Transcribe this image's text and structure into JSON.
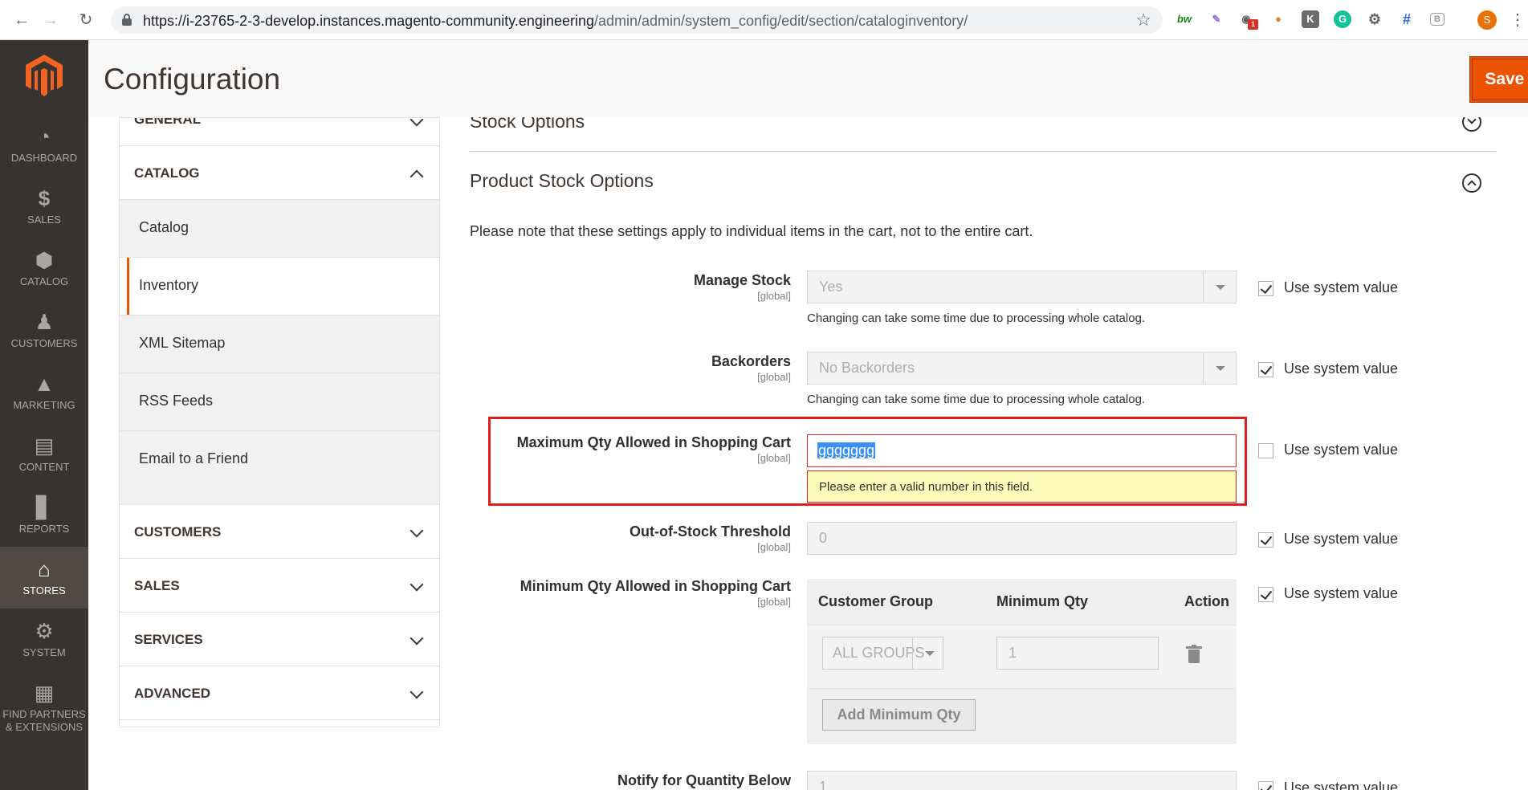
{
  "browser": {
    "url_host": "https://i-23765-2-3-develop.instances.magento-community.engineering",
    "url_path": "/admin/admin/system_config/edit/section/cataloginventory/",
    "badge_count": "1",
    "profile_initial": "S",
    "ext_bw": "bw",
    "ext_k": "K",
    "ext_g": "G",
    "ext_b": "B"
  },
  "sidebar": {
    "items": [
      {
        "label": "DASHBOARD",
        "icon": "dashboard-icon"
      },
      {
        "label": "SALES",
        "icon": "dollar-icon"
      },
      {
        "label": "CATALOG",
        "icon": "cube-icon"
      },
      {
        "label": "CUSTOMERS",
        "icon": "person-icon"
      },
      {
        "label": "MARKETING",
        "icon": "megaphone-icon"
      },
      {
        "label": "CONTENT",
        "icon": "layout-icon"
      },
      {
        "label": "REPORTS",
        "icon": "bar-chart-icon"
      },
      {
        "label": "STORES",
        "icon": "store-icon"
      },
      {
        "label": "SYSTEM",
        "icon": "gear-icon"
      },
      {
        "label_line1": "FIND PARTNERS",
        "label_line2": "& EXTENSIONS",
        "icon": "blocks-icon"
      }
    ]
  },
  "header": {
    "title": "Configuration",
    "save_label": "Save Config"
  },
  "tabs": {
    "general": "GENERAL",
    "catalog": "CATALOG",
    "catalog_items": [
      "Catalog",
      "Inventory",
      "XML Sitemap",
      "RSS Feeds",
      "Email to a Friend"
    ],
    "customers": "CUSTOMERS",
    "sales": "SALES",
    "services": "SERVICES",
    "advanced": "ADVANCED"
  },
  "main": {
    "stock_options_title": "Stock Options",
    "product_stock_title": "Product Stock Options",
    "note": "Please note that these settings apply to individual items in the cart, not to the entire cart.",
    "scope": "[global]",
    "use_system_value": "Use system value",
    "manage_stock": {
      "label": "Manage Stock",
      "value": "Yes",
      "hint": "Changing can take some time due to processing whole catalog."
    },
    "backorders": {
      "label": "Backorders",
      "value": "No Backorders",
      "hint": "Changing can take some time due to processing whole catalog."
    },
    "max_qty": {
      "label": "Maximum Qty Allowed in Shopping Cart",
      "value": "ggggggg",
      "error": "Please enter a valid number in this field."
    },
    "out_of_stock": {
      "label": "Out-of-Stock Threshold",
      "value": "0"
    },
    "min_qty": {
      "label": "Minimum Qty Allowed in Shopping Cart",
      "col_group": "Customer Group",
      "col_qty": "Minimum Qty",
      "col_action": "Action",
      "group_value": "ALL GROUPS",
      "qty_value": "1",
      "add_label": "Add Minimum Qty"
    },
    "notify_qty": {
      "label": "Notify for Quantity Below",
      "value": "1"
    }
  },
  "colors": {
    "accent": "#eb5202",
    "sidebar_bg": "#373330",
    "error_border": "#e22626",
    "highlight": "#e31b1b"
  }
}
